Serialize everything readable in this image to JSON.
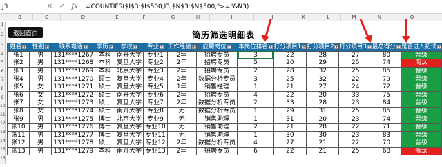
{
  "formula_bar": {
    "name_box": "J3",
    "cancel_icon": "✕",
    "enter_icon": "✓",
    "fx": "fx",
    "formula": "=COUNTIFS($I$3:$I$500,I3,$N$3:$N$500,\">=\"&N3)"
  },
  "col_letters": [
    "B",
    "C",
    "D",
    "E",
    "F",
    "G",
    "H",
    "I",
    "J",
    "K",
    "L",
    "M",
    "N",
    "O"
  ],
  "row_numbers": [
    "1",
    "2",
    "3",
    "4",
    "5",
    "6",
    "7",
    "8",
    "9",
    "10",
    "11",
    "12",
    "13",
    "14",
    "15",
    "16"
  ],
  "back_button": "返回首页",
  "title": "简历筛选明细表",
  "headers": [
    "姓名",
    "性别",
    "联系电话",
    "学历",
    "学校",
    "专业",
    "工作经验",
    "应聘岗位",
    "本岗位排名",
    "打分项目1",
    "打分项目2",
    "打分项目3",
    "最总得分",
    "是否进入初试"
  ],
  "rows": [
    [
      "张1",
      "男",
      "131****1267",
      "本科",
      "南开大学",
      "专业1",
      "2年",
      "招聘专员",
      "3",
      "22",
      "28",
      "27",
      "80",
      "晋级"
    ],
    [
      "张2",
      "男",
      "131****1268",
      "本科",
      "复旦大学",
      "专业2",
      "2年",
      "招聘专员",
      "5",
      "20",
      "29",
      "25",
      "74",
      "淘汰"
    ],
    [
      "张3",
      "男",
      "131****1269",
      "本科",
      "北京大学",
      "专业3",
      "2年",
      "招聘专员",
      "2",
      "28",
      "32",
      "25",
      "85",
      "晋级"
    ],
    [
      "张4",
      "男",
      "131****1270",
      "硕士",
      "复旦大学",
      "专业4",
      "2年",
      "数据分析专员",
      "3",
      "25",
      "32",
      "22",
      "79",
      "晋级"
    ],
    [
      "张5",
      "女",
      "131****1271",
      "硕士",
      "复旦大学",
      "专业5",
      "1年",
      "销售经理",
      "1",
      "21",
      "27",
      "24",
      "72",
      "晋级"
    ],
    [
      "张6",
      "女",
      "131****1272",
      "硕士",
      "南开大学",
      "专业6",
      "2年",
      "招聘专员",
      "4",
      "22",
      "20",
      "33",
      "75",
      "晋级"
    ],
    [
      "张7",
      "女",
      "131****1273",
      "硕士",
      "复旦大学",
      "专业7",
      "2年",
      "数据分析专员",
      "2",
      "33",
      "28",
      "23",
      "84",
      "晋级"
    ],
    [
      "张8",
      "女",
      "131****1274",
      "硕士",
      "南开大学",
      "专业8",
      "无",
      "数据分析专员",
      "1",
      "29",
      "31",
      "25",
      "85",
      "晋级"
    ],
    [
      "张9",
      "男",
      "131****1275",
      "博士",
      "北京大学",
      "专业9",
      "无",
      "销售助理",
      "1",
      "31",
      "20",
      "23",
      "74",
      "晋级"
    ],
    [
      "张10",
      "男",
      "131****1276",
      "博士",
      "复旦大学",
      "专业10",
      "无",
      "销售助理",
      "2",
      "21",
      "28",
      "22",
      "71",
      "晋级"
    ],
    [
      "张11",
      "男",
      "131****1277",
      "博士",
      "复旦大学",
      "专业11",
      "无",
      "销售助理",
      "1",
      "30",
      "30",
      "23",
      "83",
      "晋级"
    ],
    [
      "张12",
      "男",
      "131****1278",
      "硕士",
      "复旦大学",
      "专业12",
      "2年",
      "数据分析专员",
      "4",
      "27",
      "21",
      "22",
      "70",
      "晋级"
    ],
    [
      "张13",
      "男",
      "131****1279",
      "本科",
      "南开大学",
      "专业13",
      "2年",
      "招聘专员",
      "6",
      "22",
      "21",
      "25",
      "68",
      "淘汰"
    ]
  ],
  "status_colors": {
    "pass": "#1a9e44",
    "fail": "#e3201b"
  }
}
